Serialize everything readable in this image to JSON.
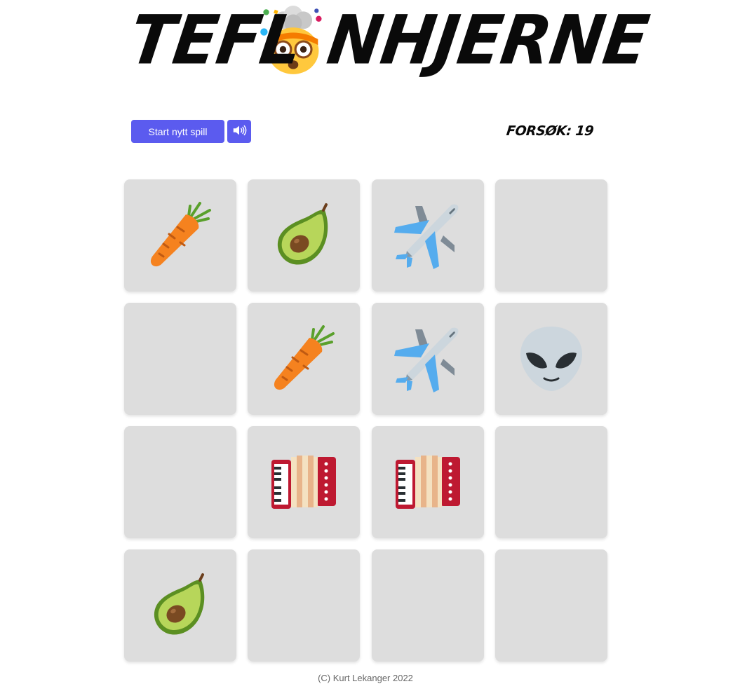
{
  "header": {
    "title_before_icon": "TEFL",
    "title_icon": "exploding-head-icon",
    "title_after_icon": "NHJERNE"
  },
  "controls": {
    "new_game_label": "Start nytt spill",
    "sound_icon": "speaker-on-icon",
    "attempts_label": "FORSØK:",
    "attempts_value": "19",
    "accent_color": "#5b5bef"
  },
  "board": {
    "card_color": "#dddddd",
    "cards": [
      {
        "state": "revealed",
        "icon": "carrot"
      },
      {
        "state": "revealed",
        "icon": "avocado"
      },
      {
        "state": "revealed",
        "icon": "airplane"
      },
      {
        "state": "hidden",
        "icon": ""
      },
      {
        "state": "hidden",
        "icon": ""
      },
      {
        "state": "revealed",
        "icon": "carrot"
      },
      {
        "state": "revealed",
        "icon": "airplane"
      },
      {
        "state": "revealed",
        "icon": "alien"
      },
      {
        "state": "hidden",
        "icon": ""
      },
      {
        "state": "revealed",
        "icon": "accordion"
      },
      {
        "state": "revealed",
        "icon": "accordion"
      },
      {
        "state": "hidden",
        "icon": ""
      },
      {
        "state": "revealed",
        "icon": "avocado"
      },
      {
        "state": "hidden",
        "icon": ""
      },
      {
        "state": "hidden",
        "icon": ""
      },
      {
        "state": "hidden",
        "icon": ""
      }
    ]
  },
  "footer": {
    "copyright": "(C) Kurt Lekanger 2022"
  }
}
